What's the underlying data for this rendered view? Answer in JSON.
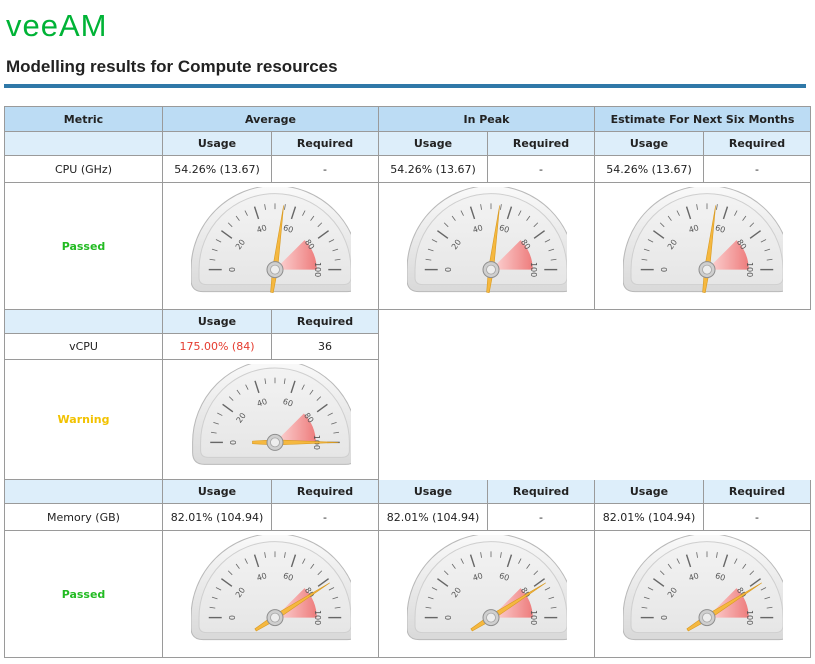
{
  "brand": {
    "logo_text": "veeAM"
  },
  "page": {
    "title": "Modelling results for Compute resources"
  },
  "table": {
    "metric_header": "Metric",
    "groups": [
      "Average",
      "In Peak",
      "Estimate For Next Six Months"
    ],
    "sub_headers": {
      "usage": "Usage",
      "required": "Required"
    }
  },
  "sections": {
    "cpu": {
      "label": "CPU (GHz)",
      "status": "Passed",
      "cells": [
        {
          "usage": "54.26% (13.67)",
          "required": "-"
        },
        {
          "usage": "54.26% (13.67)",
          "required": "-"
        },
        {
          "usage": "54.26% (13.67)",
          "required": "-"
        }
      ],
      "gauge_percent": [
        54.26,
        54.26,
        54.26
      ]
    },
    "vcpu": {
      "label": "vCPU",
      "status": "Warning",
      "cells": [
        {
          "usage": "175.00% (84)",
          "required": "36"
        }
      ],
      "gauge_percent": [
        175
      ]
    },
    "memory": {
      "label": "Memory (GB)",
      "status": "Passed",
      "cells": [
        {
          "usage": "82.01% (104.94)",
          "required": "-"
        },
        {
          "usage": "82.01% (104.94)",
          "required": "-"
        },
        {
          "usage": "82.01% (104.94)",
          "required": "-"
        }
      ],
      "gauge_percent": [
        82.01,
        82.01,
        82.01
      ]
    }
  },
  "gauge": {
    "tick_labels": [
      "0",
      "20",
      "40",
      "60",
      "80",
      "100"
    ],
    "red_zone_start": 75,
    "max": 100
  },
  "colors": {
    "passed": "#22bb22",
    "warning": "#f2c200",
    "warning_value": "#e53b2e",
    "header_bg": "#bcdcf4",
    "subheader_bg": "#ddeefa",
    "title_rule": "#2f78a8",
    "logo": "#00b336",
    "needle": "#f5b840"
  }
}
